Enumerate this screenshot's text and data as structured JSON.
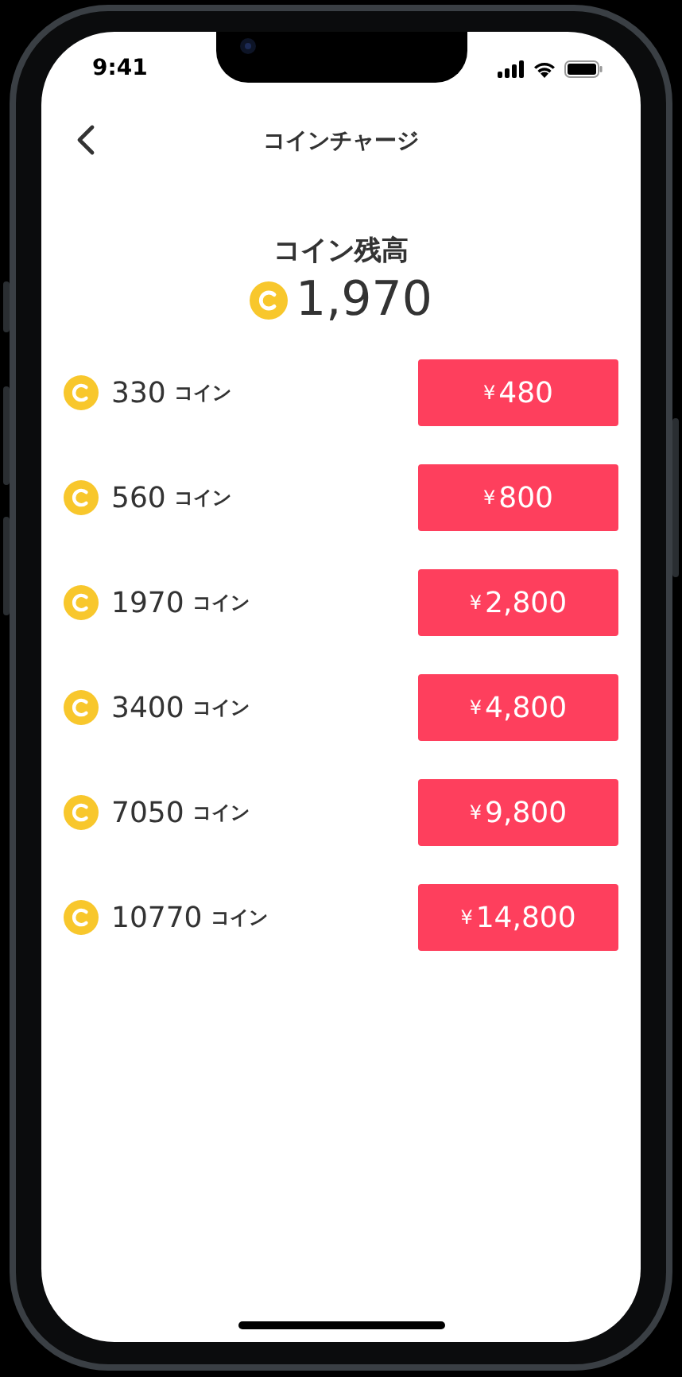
{
  "status_bar": {
    "time": "9:41"
  },
  "header": {
    "title": "コインチャージ"
  },
  "balance": {
    "label": "コイン残高",
    "amount": "1,970"
  },
  "packages": [
    {
      "coins": "330",
      "unit": "コイン",
      "currency": "¥",
      "price": "480"
    },
    {
      "coins": "560",
      "unit": "コイン",
      "currency": "¥",
      "price": "800"
    },
    {
      "coins": "1970",
      "unit": "コイン",
      "currency": "¥",
      "price": "2,800"
    },
    {
      "coins": "3400",
      "unit": "コイン",
      "currency": "¥",
      "price": "4,800"
    },
    {
      "coins": "7050",
      "unit": "コイン",
      "currency": "¥",
      "price": "9,800"
    },
    {
      "coins": "10770",
      "unit": "コイン",
      "currency": "¥",
      "price": "14,800"
    }
  ]
}
